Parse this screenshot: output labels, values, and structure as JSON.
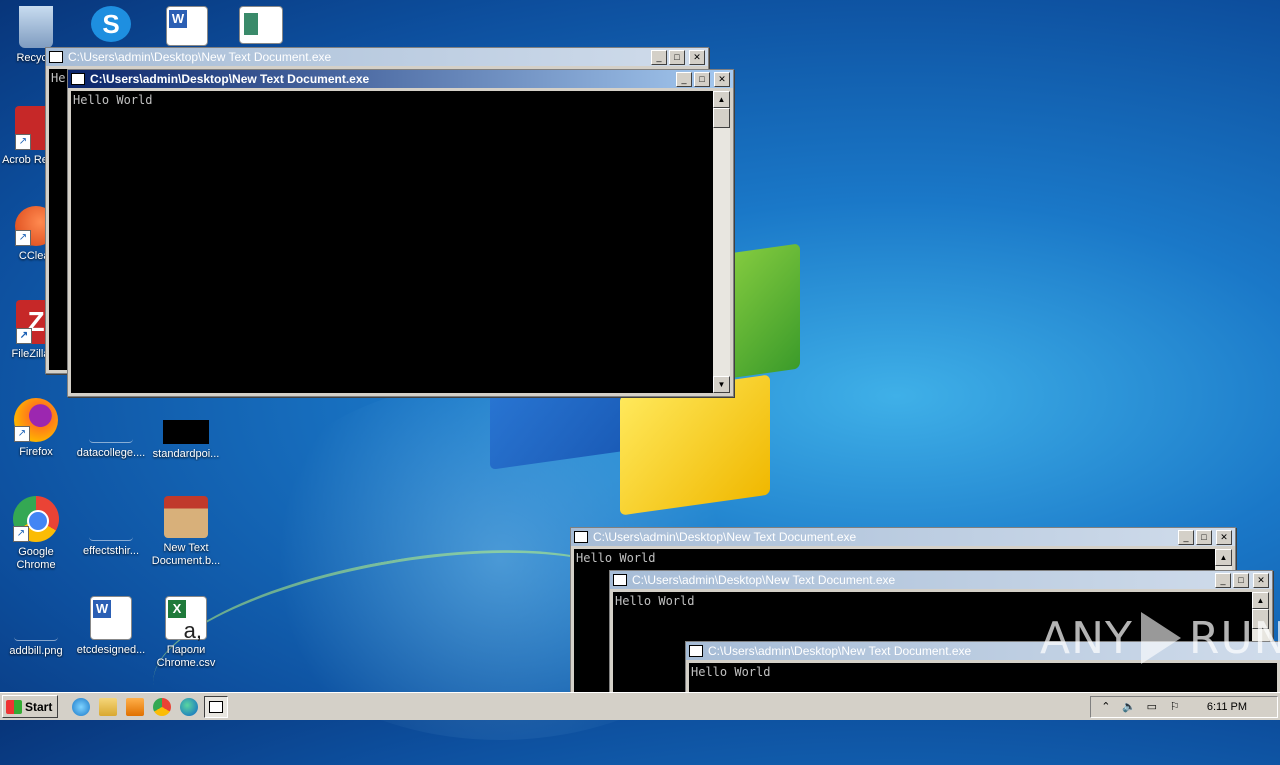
{
  "desktop": {
    "icons": [
      {
        "label": "Recycle",
        "color": "#9fb8d8"
      },
      {
        "label": "",
        "color": "#1e8fe0"
      },
      {
        "label": "",
        "color": "#2b5fb4"
      },
      {
        "label": "",
        "color": "#3a8a6a"
      },
      {
        "label": "Acrob Reader",
        "color": "#c62828"
      },
      {
        "label": "CClear",
        "color": "#d84315"
      },
      {
        "label": "FileZilla C",
        "color": "#c62828"
      },
      {
        "label": "Firefox",
        "color": "#ff7a1a"
      },
      {
        "label": "datacollege....",
        "color": "#1a78c8"
      },
      {
        "label": "standardpoi...",
        "color": "#000000"
      },
      {
        "label": "Google Chrome",
        "color": "#34a853"
      },
      {
        "label": "effectsthir...",
        "color": "#1a78c8"
      },
      {
        "label": "New Text Document.b...",
        "color": "#c9a060"
      },
      {
        "label": "addbill.png",
        "color": "#1a78c8"
      },
      {
        "label": "etcdesigned...",
        "color": "#2b5fb4"
      },
      {
        "label": "Пароли Chrome.csv",
        "color": "#1f7a3a"
      }
    ]
  },
  "windows": [
    {
      "title": "C:\\Users\\admin\\Desktop\\New Text Document.exe",
      "output": "He",
      "active": false
    },
    {
      "title": "C:\\Users\\admin\\Desktop\\New Text Document.exe",
      "output": "Hello World",
      "active": true
    },
    {
      "title": "C:\\Users\\admin\\Desktop\\New Text Document.exe",
      "output": "Hello World",
      "active": false
    },
    {
      "title": "C:\\Users\\admin\\Desktop\\New Text Document.exe",
      "output": "Hello World",
      "active": false
    },
    {
      "title": "C:\\Users\\admin\\Desktop\\New Text Document.exe",
      "output": "Hello World",
      "active": false
    }
  ],
  "window_buttons": {
    "minimize": "_",
    "maximize": "□",
    "close": "✕"
  },
  "scroll_arrows": {
    "up": "▲",
    "down": "▼"
  },
  "taskbar": {
    "start_label": "Start",
    "quick_launch": [
      "ie-icon",
      "explorer-icon",
      "media-player-icon",
      "chrome-icon",
      "edge-icon"
    ],
    "tray_icons": {
      "expand": "⌃",
      "volume": "🔈",
      "network": "▭",
      "flag": "⚐"
    },
    "clock": "6:11 PM"
  },
  "watermark": {
    "left": "ANY",
    "right": "RUN"
  }
}
